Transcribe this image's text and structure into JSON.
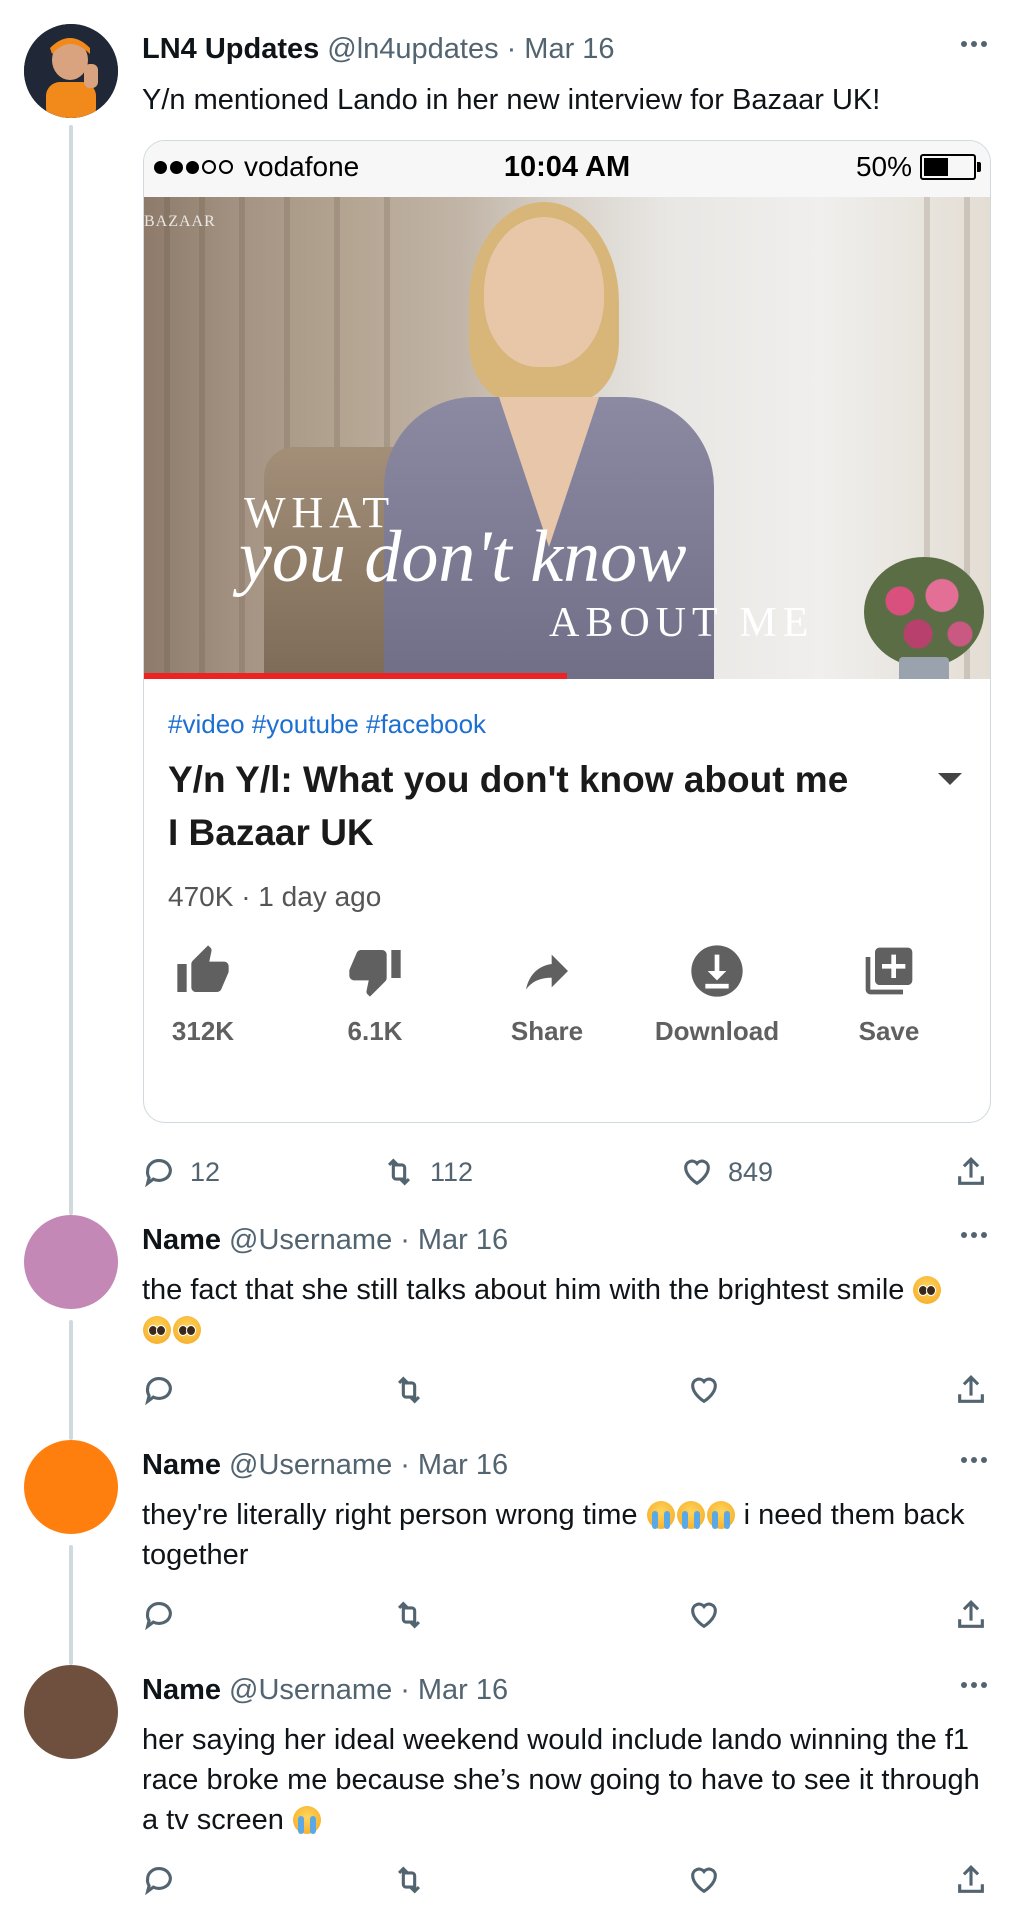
{
  "main_tweet": {
    "display_name": "LN4 Updates",
    "handle": "@ln4updates",
    "date": "Mar 16",
    "text": "Y/n mentioned Lando in her new interview for Bazaar UK!",
    "embedded_screenshot": {
      "status_bar": {
        "carrier": "vodafone",
        "time": "10:04 AM",
        "battery": "50%"
      },
      "thumbnail": {
        "watermark": "BAZAAR",
        "overlay_line1": "WHAT",
        "overlay_line2": "you don't know",
        "overlay_line3": "ABOUT ME",
        "progress_fraction": 0.5
      },
      "hashtags": "#video #youtube #facebook",
      "video_title": "Y/n Y/l: What you don't know about me I Bazaar UK",
      "views": "470K",
      "age": "· 1 day ago",
      "actions": [
        {
          "icon": "thumbs-up-icon",
          "label": "312K"
        },
        {
          "icon": "thumbs-down-icon",
          "label": "6.1K"
        },
        {
          "icon": "share-arrow-icon",
          "label": "Share"
        },
        {
          "icon": "download-icon",
          "label": "Download"
        },
        {
          "icon": "add-to-playlist-icon",
          "label": "Save"
        }
      ]
    },
    "stats": {
      "replies": "12",
      "retweets": "112",
      "likes": "849"
    }
  },
  "replies": [
    {
      "display_name": "Name",
      "handle": "@Username",
      "date": "Mar 16",
      "avatar_color": "#c388b6",
      "text_a": "the fact that she still talks about him with the brightest smile",
      "text_b": ""
    },
    {
      "display_name": "Name",
      "handle": "@Username",
      "date": "Mar 16",
      "avatar_color": "#ff7f0e",
      "text_a": "they're literally right person wrong time",
      "text_b": "i need them back together"
    },
    {
      "display_name": "Name",
      "handle": "@Username",
      "date": "Mar 16",
      "avatar_color": "#6f4f3e",
      "text_a": "her saying her ideal weekend would include lando winning the f1 race broke me because she’s now going to have to see it through a tv screen",
      "text_b": ""
    }
  ],
  "colors": {
    "thread_line": "#cfd9de",
    "muted_text": "#536471",
    "link": "#1d6fd1"
  }
}
